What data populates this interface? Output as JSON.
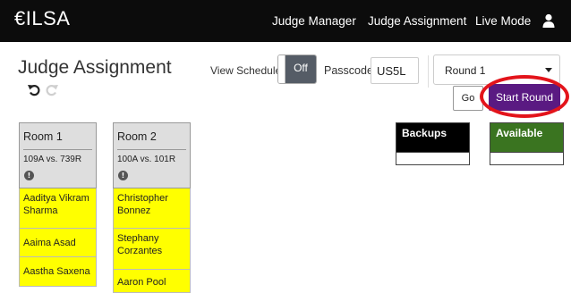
{
  "navbar": {
    "brand": "€ILSA",
    "links": [
      "Judge Manager",
      "Judge Assignment",
      "Live Mode"
    ],
    "user_icon": "user-icon"
  },
  "page": {
    "title": "Judge Assignment",
    "undo_icon": "undo-icon",
    "redo_icon": "redo-icon"
  },
  "controls": {
    "view_schedule_label": "View Schedule",
    "toggle_state": "Off",
    "passcode_label": "Passcode",
    "passcode_value": "US5L",
    "round_selected": "Round 1",
    "go_label": "Go",
    "start_round_label": "Start Round"
  },
  "pools": [
    {
      "label": "Backups",
      "color": "#000000"
    },
    {
      "label": "Available",
      "color": "#3a7420"
    }
  ],
  "rooms": [
    {
      "name": "Room 1",
      "match": "109A vs. 739R",
      "judges": [
        "Aaditya Vikram Sharma",
        "Aaima Asad",
        "Aastha Saxena"
      ]
    },
    {
      "name": "Room 2",
      "match": "100A vs. 101R",
      "judges": [
        "Christopher Bonnez",
        "Stephany Corzantes",
        "Aaron Pool"
      ]
    }
  ],
  "colors": {
    "navbar_bg": "#0c0c0c",
    "start_round_bg": "#5a1a82",
    "highlight_ring": "#e3141b",
    "judge_bg": "#ffff00",
    "room_header_bg": "#dedede"
  }
}
